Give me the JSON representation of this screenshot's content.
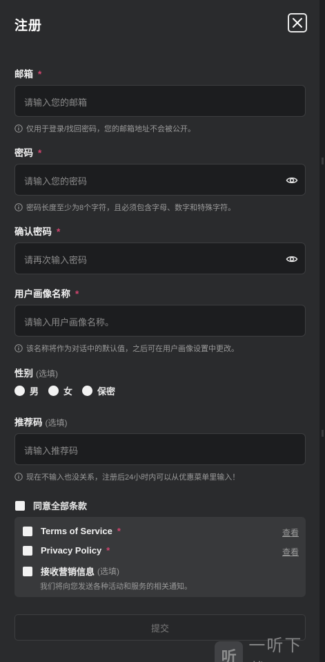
{
  "header": {
    "title": "注册"
  },
  "email": {
    "label": "邮箱",
    "placeholder": "请输入您的邮箱",
    "hint": "仅用于登录/找回密码，您的邮箱地址不会被公开。"
  },
  "password": {
    "label": "密码",
    "placeholder": "请输入您的密码",
    "hint": "密码长度至少为8个字符，且必须包含字母、数字和特殊字符。"
  },
  "confirm_password": {
    "label": "确认密码",
    "placeholder": "请再次输入密码"
  },
  "persona_name": {
    "label": "用户画像名称",
    "placeholder": "请输入用户画像名称。",
    "hint": "该名称将作为对话中的默认值，之后可在用户画像设置中更改。"
  },
  "gender": {
    "label": "性别",
    "optional": "(选填)",
    "options": [
      "男",
      "女",
      "保密"
    ]
  },
  "referral": {
    "label": "推荐码",
    "optional": "(选填)",
    "placeholder": "请输入推荐码",
    "hint": "现在不输入也没关系，注册后24小时内可以从优惠菜单里输入！"
  },
  "agreements": {
    "all_label": "同意全部条款",
    "items": [
      {
        "label": "Terms of Service",
        "view": "查看"
      },
      {
        "label": "Privacy Policy",
        "view": "查看"
      },
      {
        "label": "接收营销信息",
        "optional": "(选填)",
        "desc": "我们将向您发送各种活动和服务的相关通知。"
      }
    ]
  },
  "submit": {
    "label": "提交"
  },
  "watermark": {
    "logo": "听",
    "text": "一听下载"
  },
  "colors": {
    "background": "#2a2b2d",
    "input_bg": "#1c1d1f",
    "required_star": "#d1456f",
    "box_bg": "#38393b"
  }
}
